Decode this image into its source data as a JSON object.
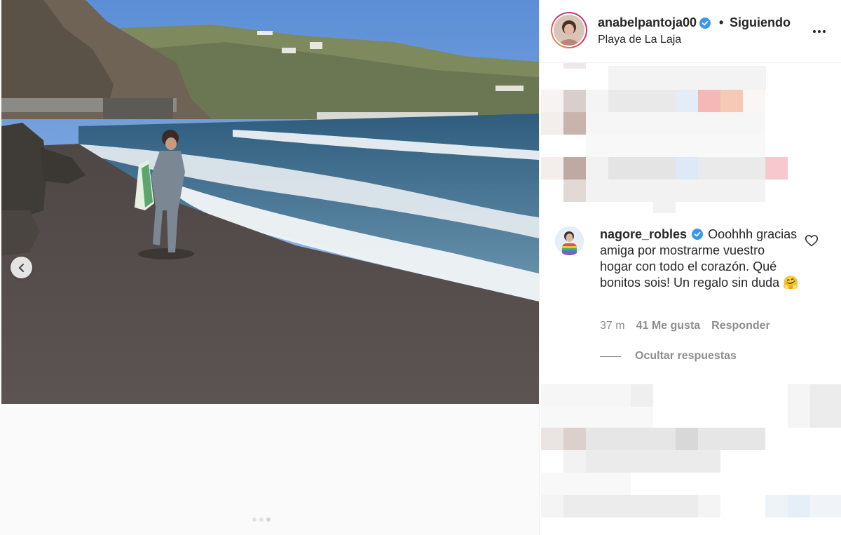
{
  "post": {
    "username": "anabelpantoja00",
    "separator": "•",
    "follow_label": "Siguiendo",
    "location": "Playa de La Laja"
  },
  "comment": {
    "username": "nagore_robles",
    "text": "Ooohhh gracias amiga por mostrarme vuestro hogar con todo el corazón. Qué bonitos sois! Un regalo sin duda 🤗",
    "time": "37 m",
    "likes": "41 Me gusta",
    "reply_label": "Responder",
    "hide_replies_label": "Ocultar respuestas"
  },
  "icons": {
    "verified": "verified-badge-icon",
    "more": "more-options-icon",
    "heart": "heart-icon",
    "prev": "chevron-left-icon"
  },
  "colors": {
    "verified_blue": "#3897f0",
    "text_primary": "#262626",
    "text_secondary": "#8e8e8e"
  },
  "carousel": {
    "slide_count": 3,
    "active_index": 2
  }
}
